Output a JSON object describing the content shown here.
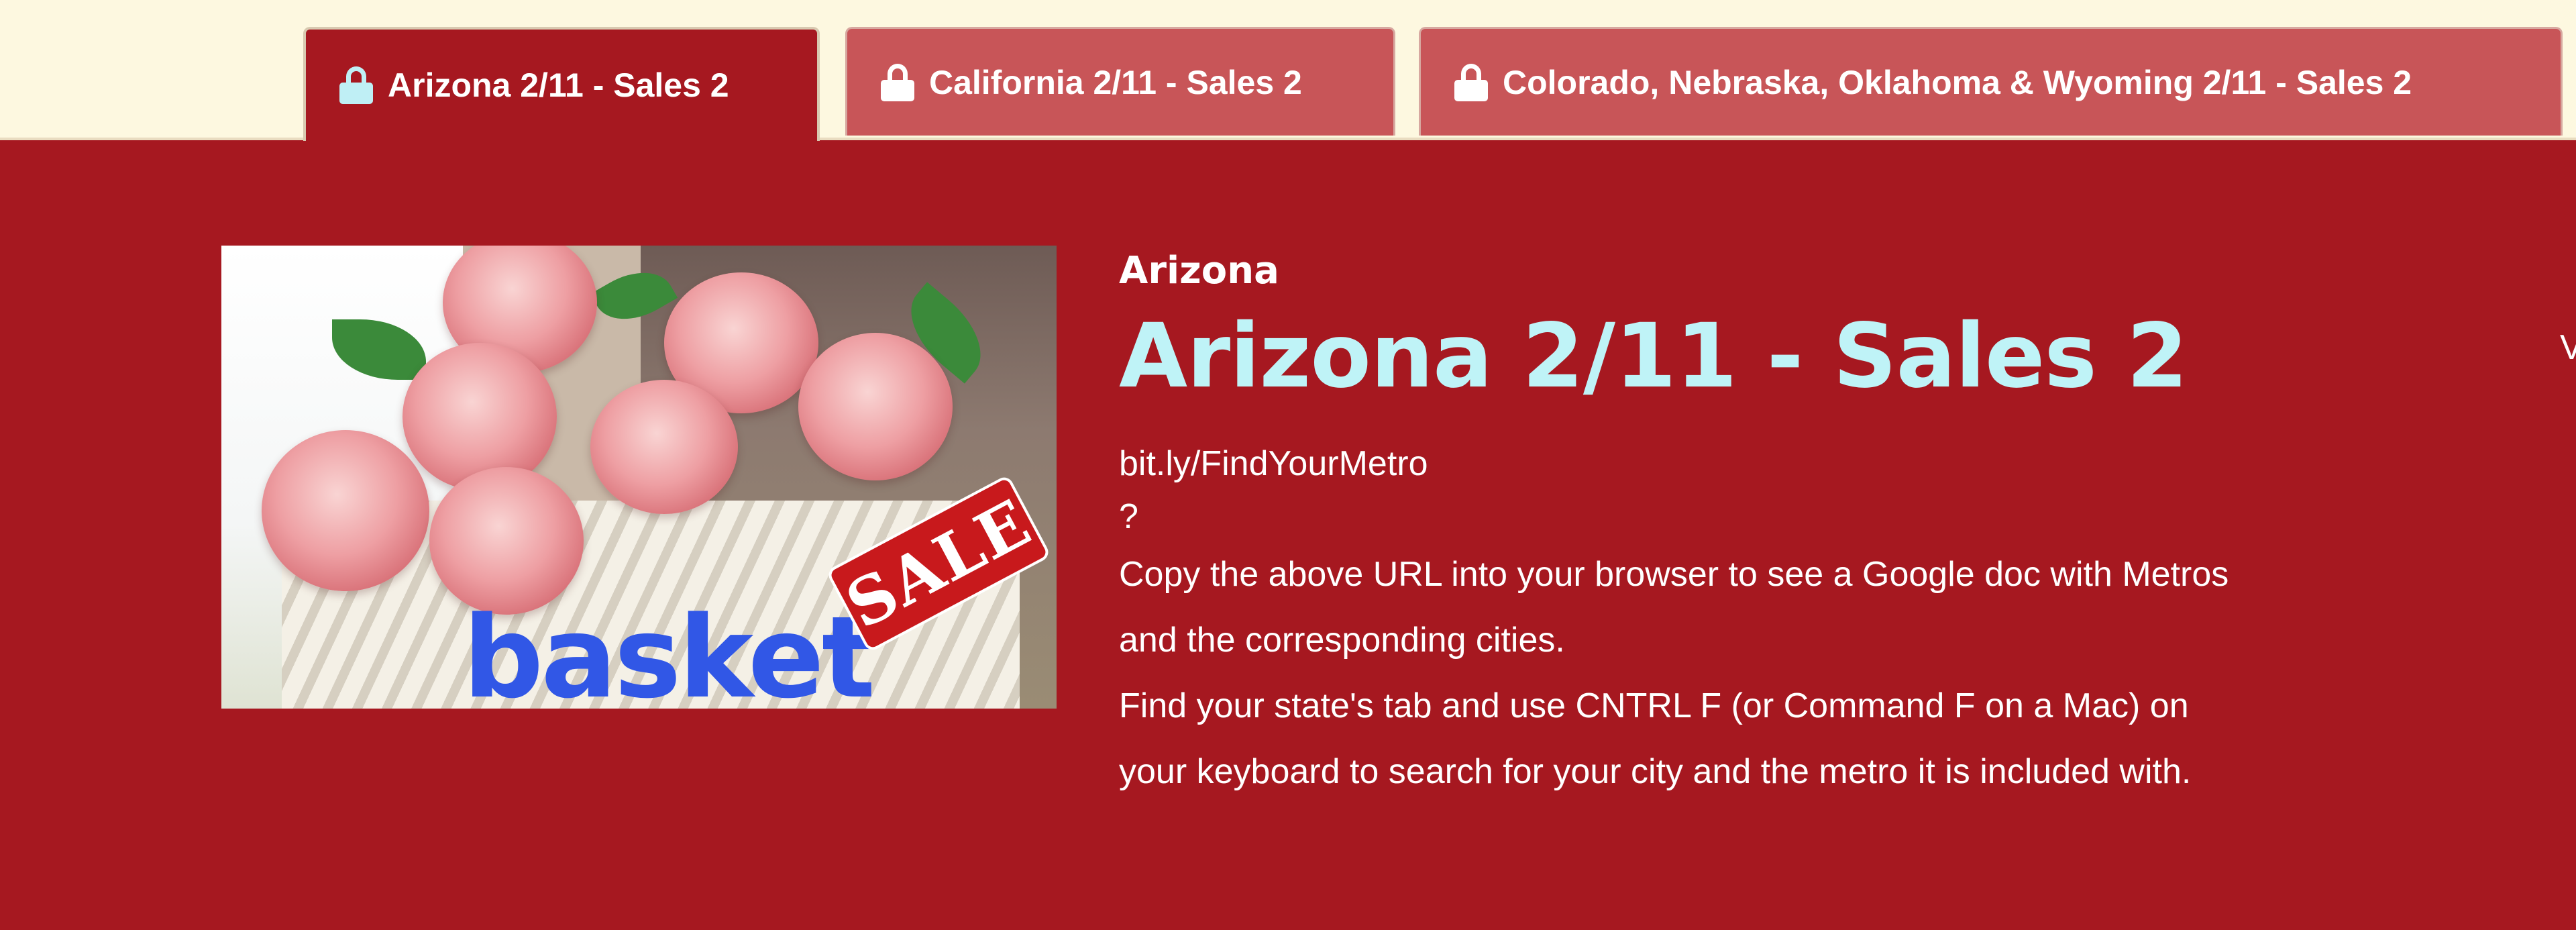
{
  "tabs": [
    {
      "label": "Arizona 2/11 - Sales 2",
      "icon": "lock-icon",
      "active": true
    },
    {
      "label": "California 2/11 - Sales 2",
      "icon": "lock-icon",
      "active": false
    },
    {
      "label": "Colorado, Nebraska, Oklahoma & Wyoming 2/11 - Sales 2",
      "icon": "lock-icon",
      "active": false
    }
  ],
  "hero": {
    "brand_word": "basket",
    "sale_word": "SALE"
  },
  "content": {
    "state_label": "Arizona",
    "title": "Arizona 2/11 - Sales 2",
    "link": "bit.ly/FindYourMetro",
    "question_mark": "?",
    "description_1": "Copy the above URL into your browser to see a Google doc with Metros and the corresponding cities.",
    "description_2": "Find your state's tab and use CNTRL F (or Command F on a Mac) on your keyboard to search for your city and the metro it is included with."
  },
  "edge_text": "V",
  "colors": {
    "page_background": "#a61820",
    "topbar_background": "#fdf8e0",
    "inactive_tab": "#c85558",
    "title_accent": "#bff3f7",
    "brand_blue": "#3157e6"
  }
}
